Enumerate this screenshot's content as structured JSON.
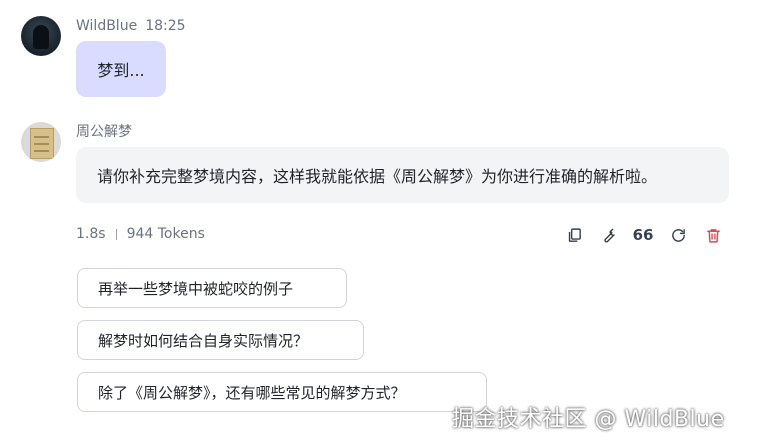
{
  "user_message": {
    "sender": "WildBlue",
    "time": "18:25",
    "text": "梦到..."
  },
  "bot_message": {
    "sender": "周公解梦",
    "text": "请你补充完整梦境内容，这样我就能依据《周公解梦》为你进行准确的解析啦。",
    "latency": "1.8s",
    "tokens": "944 Tokens"
  },
  "toolbar": {
    "icons": [
      "copy-icon",
      "wrench-icon",
      "quote-icon",
      "refresh-icon",
      "delete-icon"
    ],
    "quote_label": "66",
    "delete_color": "#e5484d"
  },
  "suggestions": [
    "再举一些梦境中被蛇咬的例子",
    "解梦时如何结合自身实际情况？",
    "除了《周公解梦》，还有哪些常见的解梦方式？"
  ],
  "watermark": "掘金技术社区 @ WildBlue",
  "colors": {
    "user_bubble": "#d9dbff",
    "bot_bubble": "#f3f4f6",
    "muted_text": "#6b7280"
  }
}
